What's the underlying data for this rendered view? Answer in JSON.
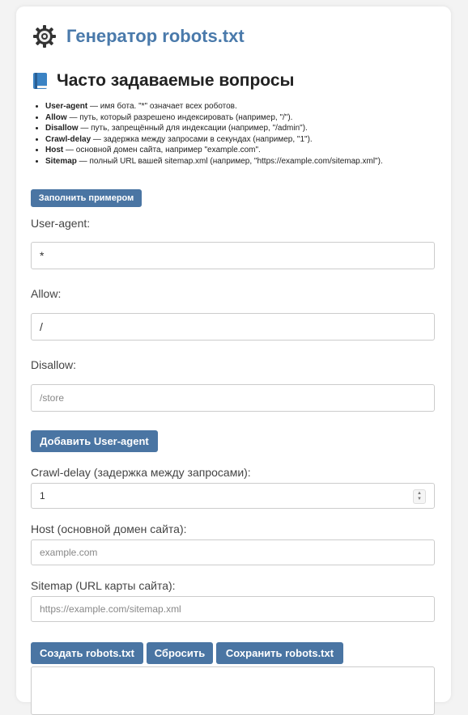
{
  "header": {
    "title": "Генератор robots.txt",
    "icon": "gear-icon"
  },
  "faq": {
    "title": "Часто задаваемые вопросы",
    "icon": "book-icon",
    "items": [
      {
        "term": "User-agent",
        "text": " — имя бота. \"*\" означает всех роботов."
      },
      {
        "term": "Allow",
        "text": " — путь, который разрешено индексировать (например, \"/\")."
      },
      {
        "term": "Disallow",
        "text": " — путь, запрещённый для индексации (например, \"/admin\")."
      },
      {
        "term": "Crawl-delay",
        "text": " — задержка между запросами в секундах (например, \"1\")."
      },
      {
        "term": "Host",
        "text": " — основной домен сайта, например \"example.com\"."
      },
      {
        "term": "Sitemap",
        "text": " — полный URL вашей sitemap.xml (например, \"https://example.com/sitemap.xml\")."
      }
    ]
  },
  "buttons": {
    "fill_example": "Заполнить примером",
    "add_user_agent": "Добавить User-agent",
    "create": "Создать robots.txt",
    "reset": "Сбросить",
    "save": "Сохранить robots.txt"
  },
  "form": {
    "user_agent": {
      "label": "User-agent:",
      "value": "*"
    },
    "allow": {
      "label": "Allow:",
      "value": "/"
    },
    "disallow": {
      "label": "Disallow:",
      "placeholder": "/store"
    },
    "crawl_delay": {
      "label": "Crawl-delay (задержка между запросами):",
      "value": "1"
    },
    "host": {
      "label": "Host (основной домен сайта):",
      "placeholder": "example.com"
    },
    "sitemap": {
      "label": "Sitemap (URL карты сайта):",
      "placeholder": "https://example.com/sitemap.xml"
    }
  },
  "colors": {
    "accent": "#4a7aab",
    "button": "#4a75a3"
  }
}
